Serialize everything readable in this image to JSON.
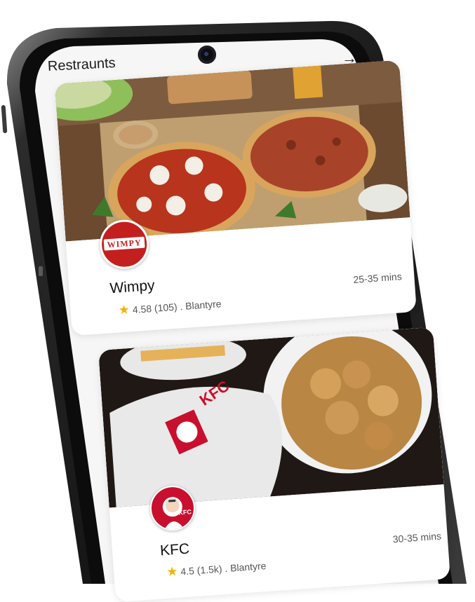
{
  "header": {
    "title": "Restraunts",
    "forward_icon": "arrow-right-icon"
  },
  "restaurants": [
    {
      "name": "Wimpy",
      "logo_text": "WIMPY",
      "rating": "4.58",
      "reviews": "(105)",
      "location": ". Blantyre",
      "delivery_time": "25-35 mins"
    },
    {
      "name": "KFC",
      "logo_text": "KFC",
      "rating": "4.5",
      "reviews": "(1.5k)",
      "location": ". Blantyre",
      "delivery_time": "30-35 mins"
    }
  ],
  "colors": {
    "wimpy_red": "#c41f1f",
    "kfc_red": "#c8102e",
    "star": "#f3b400"
  }
}
